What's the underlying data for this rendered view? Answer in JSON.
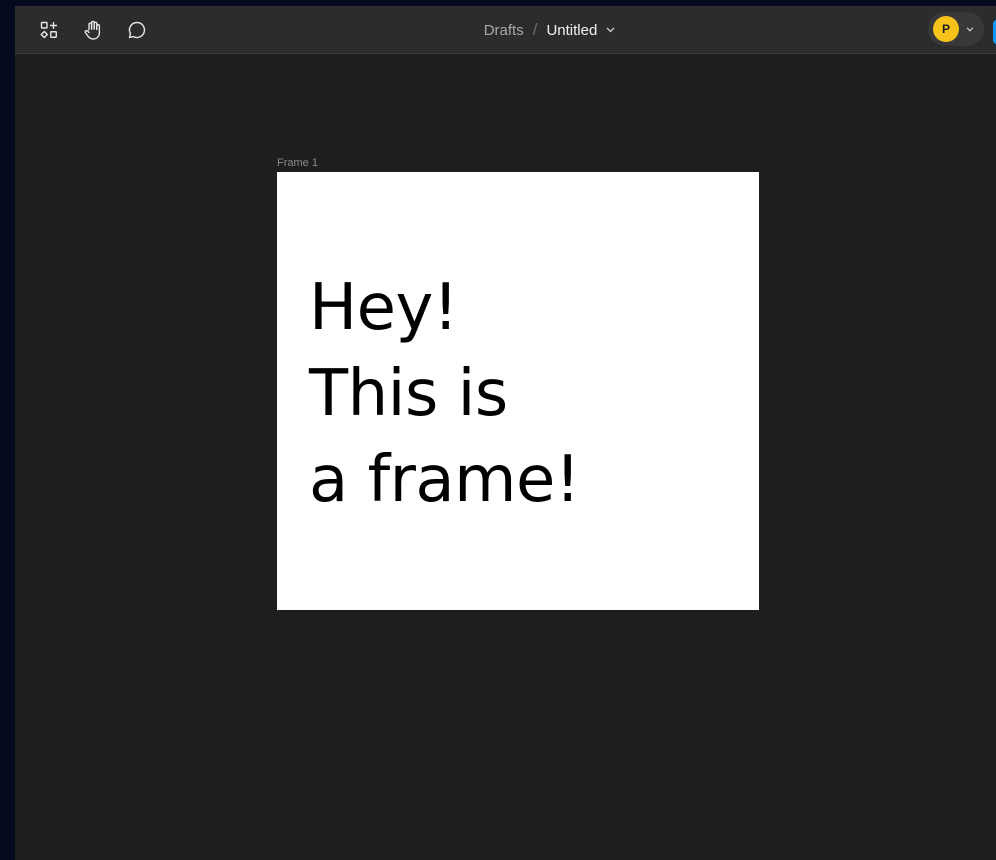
{
  "toolbar": {
    "tools": [
      {
        "name": "actions",
        "icon": "actions-icon"
      },
      {
        "name": "hand",
        "icon": "hand-icon"
      },
      {
        "name": "comment",
        "icon": "comment-icon"
      }
    ]
  },
  "breadcrumb": {
    "folder": "Drafts",
    "separator": "/",
    "file": "Untitled",
    "chevron_icon": "chevron-down-icon"
  },
  "user": {
    "initial": "P",
    "avatar_color": "#f7c31a"
  },
  "canvas": {
    "frame": {
      "label": "Frame 1",
      "text_lines": [
        "Hey!",
        "This is",
        "a frame!"
      ]
    }
  },
  "colors": {
    "canvas_bg": "#1e1e1e",
    "toolbar_bg": "#2c2c2c",
    "accent": "#0d99ff",
    "frame_fill": "#ffffff"
  }
}
